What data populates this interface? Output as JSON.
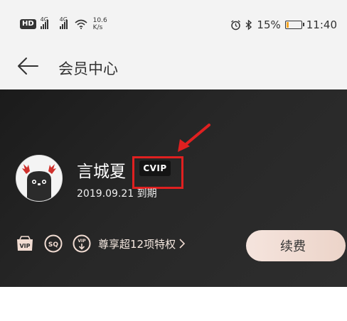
{
  "status_bar": {
    "hd": "HD",
    "network_1": "4G",
    "network_2": "4G",
    "speed_value": "10.6",
    "speed_unit": "K/s",
    "battery": "15%",
    "time": "11:40",
    "icons": [
      "hd-icon",
      "signal-icon",
      "wifi-icon",
      "alarm-icon",
      "bluetooth-icon",
      "battery-icon"
    ]
  },
  "nav": {
    "title": "会员中心",
    "back_icon": "back-arrow-icon"
  },
  "card": {
    "username": "言城夏",
    "vip_badge": "CVIP",
    "expire": "2019.09.21 到期",
    "privilege_text": "尊享超12项特权",
    "privilege_icons": [
      "vip-icon",
      "sq-icon",
      "vip-download-icon"
    ],
    "renew_button": "续费"
  },
  "colors": {
    "card_background": "#242424",
    "highlight": "#e02020",
    "renew_button": "#f0ddd5",
    "battery_fill": "#f5a623"
  }
}
